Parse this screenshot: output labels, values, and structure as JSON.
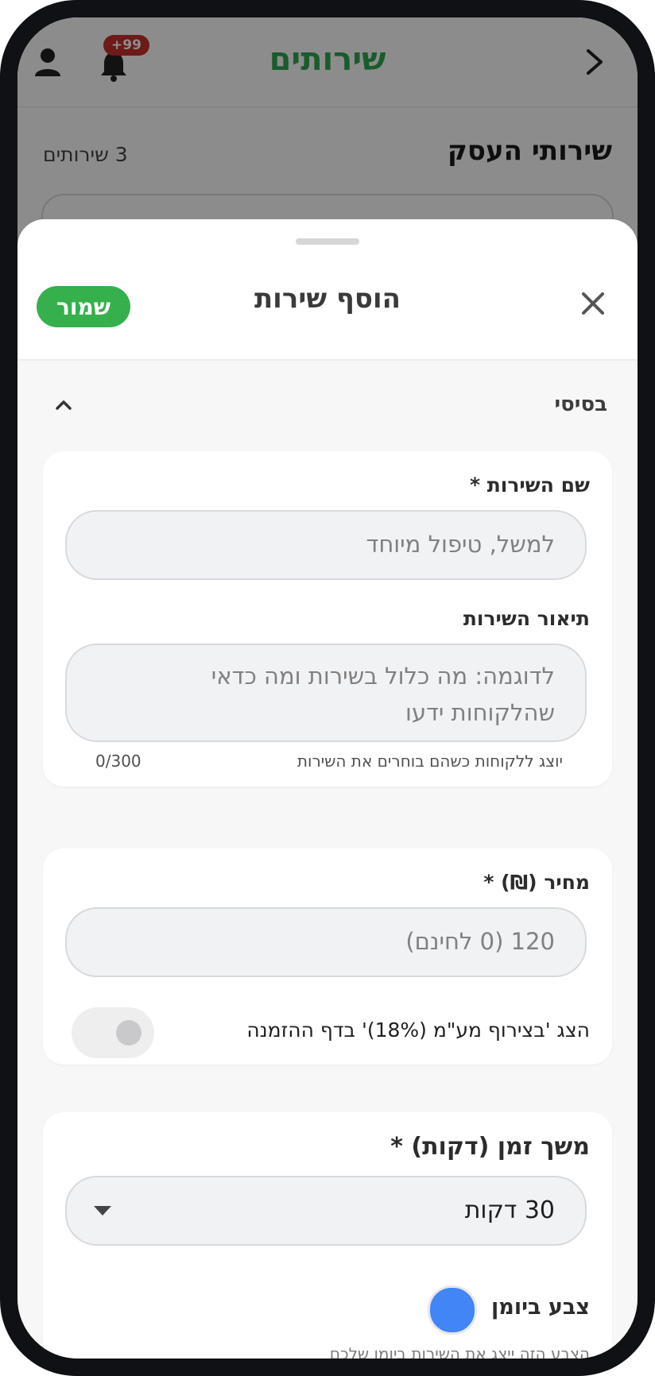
{
  "app_bar": {
    "title": "שירותים",
    "notification_badge": "+99"
  },
  "page": {
    "section_title": "שירותי העסק",
    "services_count": "3 שירותים"
  },
  "sheet": {
    "title": "הוסף שירות",
    "save_label": "שמור",
    "section_label": "בסיסי",
    "service_name": {
      "label": "שם השירות *",
      "placeholder": "למשל, טיפול מיוחד"
    },
    "description": {
      "label": "תיאור השירות",
      "placeholder_line1": "לדוגמה: מה כלול בשירות ומה כדאי",
      "placeholder_line2": "שהלקוחות ידעו",
      "helper": "יוצג ללקוחות כשהם בוחרים את השירות",
      "counter": "0/300"
    },
    "price": {
      "label": "מחיר (₪) *",
      "placeholder": "120 (0 לחינם)",
      "vat_toggle_label": "הצג 'בצירוף מע\"מ (18%)' בדף ההזמנה",
      "vat_toggle_on": false
    },
    "duration": {
      "label": "משך זמן (דקות) *",
      "selected": "30 דקות"
    },
    "calendar_color": {
      "label": "צבע ביומן",
      "helper": "הצבע הזה ייצג את השירות ביומן שלכם",
      "color": "#4285f4"
    }
  },
  "colors": {
    "brand_green": "#2fa84f",
    "save_button": "#36b04d",
    "badge_red": "#c9302c"
  }
}
